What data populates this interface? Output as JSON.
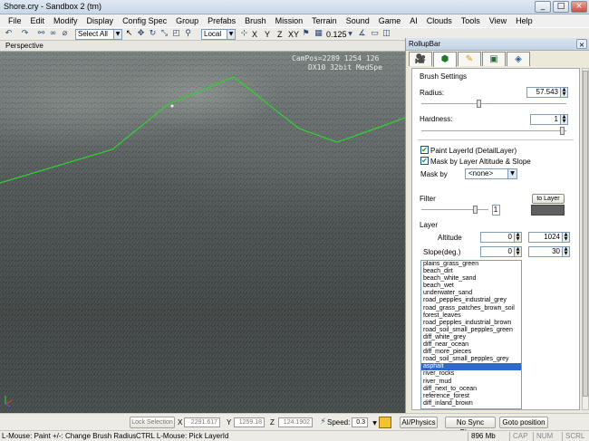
{
  "window": {
    "title": "Shore.cry - Sandbox 2 (tm)",
    "buttons": [
      "_",
      "□",
      "×"
    ]
  },
  "menu": [
    "File",
    "Edit",
    "Modify",
    "Display",
    "Config Spec",
    "Group",
    "Prefabs",
    "Brush",
    "Mission",
    "Terrain",
    "Sound",
    "Game",
    "AI",
    "Clouds",
    "Tools",
    "View",
    "Help"
  ],
  "toolbar": {
    "select_filter": "Select All",
    "coord_system": "Local",
    "axes": [
      "X",
      "Y",
      "Z",
      "XY"
    ],
    "grid_value": "0.125"
  },
  "viewport": {
    "name": "Perspective",
    "campos": "CamPos=2289 1254 126",
    "renderer": "DX10 32bit MedSpe"
  },
  "rollup": {
    "title": "RollupBar",
    "close": "×",
    "tabs": [
      "create-icon",
      "terrain-icon",
      "display-icon",
      "modify-icon",
      "layers-icon"
    ],
    "brush_settings": "Brush Settings",
    "radius_label": "Radius:",
    "radius_value": "57.543",
    "radius_fraction": 0.4,
    "hardness_label": "Hardness:",
    "hardness_value": "1",
    "hardness_fraction": 1.0,
    "paint_layer_label": "Paint LayerId (DetailLayer)",
    "mask_altitude_label": "Mask by Layer Altitude & Slope",
    "mask_by_label": "Mask by",
    "mask_by_value": "<none>",
    "filter_label": "Filter",
    "to_layer_button": "to Layer",
    "filter_value": "1",
    "filter_fraction": 0.85,
    "layer_label": "Layer",
    "altitude_label": "Altitude",
    "altitude_min": "0",
    "altitude_max": "1024",
    "slope_label": "Slope(deg.)",
    "slope_min": "0",
    "slope_max": "30",
    "layers": [
      "plains_grass_green",
      "beach_dirt",
      "beach_white_sand",
      "beach_wet",
      "underwater_sand",
      "road_pepples_industrial_grey",
      "road_grass_patches_brown_soil",
      "forest_leaves",
      "road_pepples_industrial_brown",
      "road_soil_small_pepples_green",
      "diff_white_grey",
      "diff_near_ocean",
      "diff_more_pieces",
      "road_soil_small_pepples_grey",
      "asphalt",
      "river_rocks",
      "river_mud",
      "diff_next_to_ocean",
      "reference_forest",
      "diff_inland_brown"
    ],
    "selected_layer": "asphalt"
  },
  "statusbar": {
    "lock_selection": "Lock Selection",
    "x_label": "X",
    "x_value": "2291.617",
    "y_label": "Y",
    "y_value": "1259.18",
    "z_label": "Z",
    "z_value": "124.1902",
    "speed_label": "Speed:",
    "speed_value": "0.3",
    "ai_physics": "AI/Physics",
    "no_sync_player": "No Sync Player",
    "goto_position": "Goto position",
    "hint_paint": "L-Mouse: Paint",
    "hint_radius": "+/-: Change Brush Radius",
    "hint_pick": "CTRL L-Mouse: Pick LayerId",
    "memory": "896 Mb",
    "cap": "CAP",
    "num": "NUM",
    "scrl": "SCRL"
  },
  "colors": {
    "selection": "#3169c6",
    "guide_line": "#2fd12f"
  }
}
